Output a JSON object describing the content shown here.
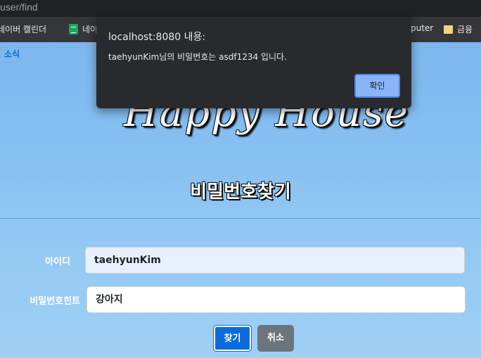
{
  "browser": {
    "url_text": "user/find",
    "bookmarks": [
      {
        "label": "네이버 캘린더",
        "icon": "bookmark-icon"
      },
      {
        "label": "네이",
        "icon": "sheets-icon"
      },
      {
        "label": "puter",
        "icon": "none"
      },
      {
        "label": "금융",
        "icon": "folder-icon"
      }
    ]
  },
  "nav": {
    "link_label": "소식"
  },
  "site": {
    "title": "Happy House"
  },
  "page": {
    "heading": "비밀번호찾기"
  },
  "form": {
    "id_label": "아이디",
    "id_value": "taehyunKim",
    "hint_label": "비밀번호힌트",
    "hint_value": "강아지",
    "find_button": "찾기",
    "cancel_button": "취소"
  },
  "dialog": {
    "title": "localhost:8080 내용:",
    "message": "taehyunKim님의 비밀번호는 asdf1234 입니다.",
    "ok_button": "확인"
  },
  "colors": {
    "primary": "#0b6bdc",
    "secondary": "#6c757d",
    "dialog_bg": "#292a2d",
    "dialog_button": "#8ab4f8"
  }
}
